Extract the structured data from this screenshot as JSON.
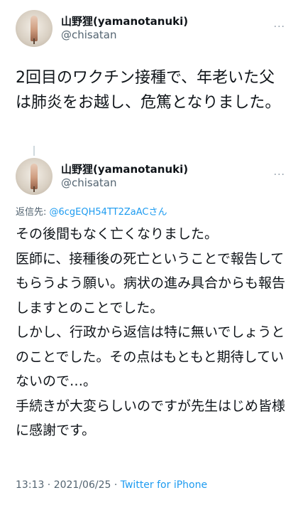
{
  "tweet1": {
    "display_name": "山野狸(yamanotanuki)",
    "handle": "@chisatan",
    "text": "2回目のワクチン接種で、年老いた父は肺炎をお越し、危篤となりました。",
    "more": "···"
  },
  "tweet2": {
    "display_name": "山野狸(yamanotanuki)",
    "handle": "@chisatan",
    "more": "···",
    "reply_prefix": "返信先: ",
    "reply_mention": "@6cgEQH54TT2ZaACさん",
    "text_lines": [
      "その後間もなく亡くなりました。",
      "医師に、接種後の死亡ということで報告してもらうよう願い。病状の進み具合からも報告しますとのことでした。",
      "しかし、行政から返信は特に無いでしょうとのことでした。その点はもともと期待していないので…。",
      "手続きが大変らしいのですが先生はじめ皆様に感謝です。"
    ],
    "timestamp": "13:13 · 2021/06/25 · ",
    "source": "Twitter for iPhone"
  },
  "colors": {
    "text": "#0f1419",
    "secondary": "#536471",
    "link": "#1d9bf0"
  }
}
